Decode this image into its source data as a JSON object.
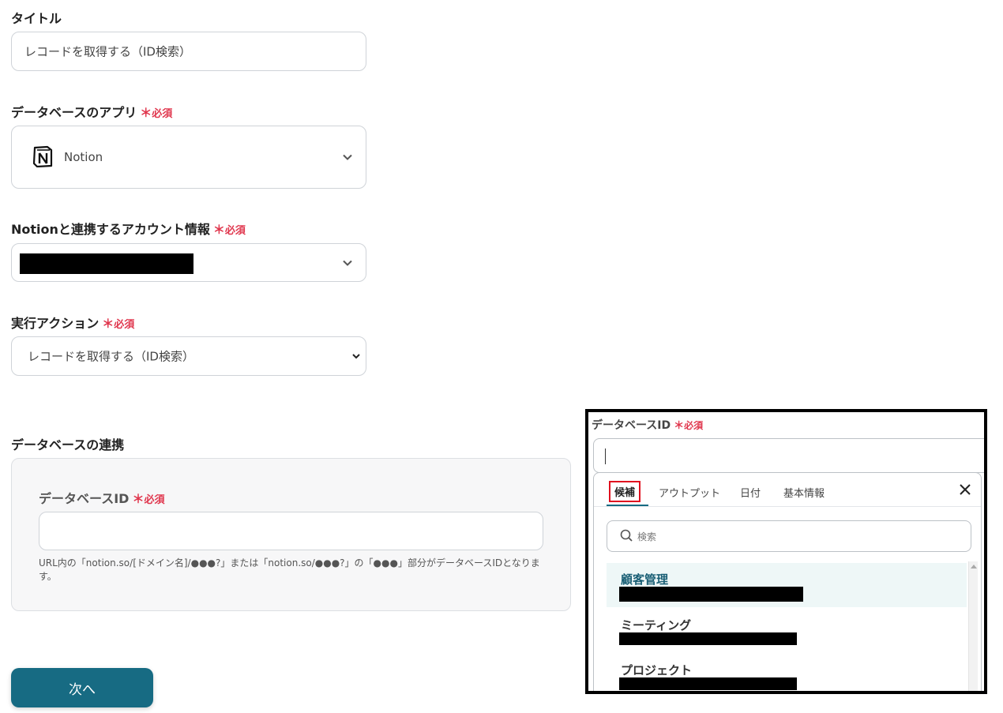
{
  "title_field": {
    "label": "タイトル",
    "value": "レコードを取得する（ID検索）"
  },
  "required_mark": {
    "star": "＊",
    "text": "必須"
  },
  "db_app": {
    "label": "データベースのアプリ",
    "value": "Notion",
    "icon": "notion-logo-icon"
  },
  "account": {
    "label": "Notionと連携するアカウント情報"
  },
  "action": {
    "label": "実行アクション",
    "value": "レコードを取得する（ID検索）"
  },
  "db_link": {
    "section_title": "データベースの連携",
    "id_label": "データベースID",
    "help_text": "URL内の「notion.so/[ドメイン名]/●●●?」または「notion.so/●●●?」の「●●●」部分がデータベースIDとなります。"
  },
  "next_button": {
    "label": "次へ"
  },
  "colors": {
    "accent": "#176b83",
    "required": "#e0364d"
  },
  "inset": {
    "label": "データベースID",
    "tabs": [
      "候補",
      "アウトプット",
      "日付",
      "基本情報"
    ],
    "search_placeholder": "検索",
    "items": [
      {
        "title": "顧客管理"
      },
      {
        "title": "ミーティング"
      },
      {
        "title": "プロジェクト"
      }
    ]
  }
}
